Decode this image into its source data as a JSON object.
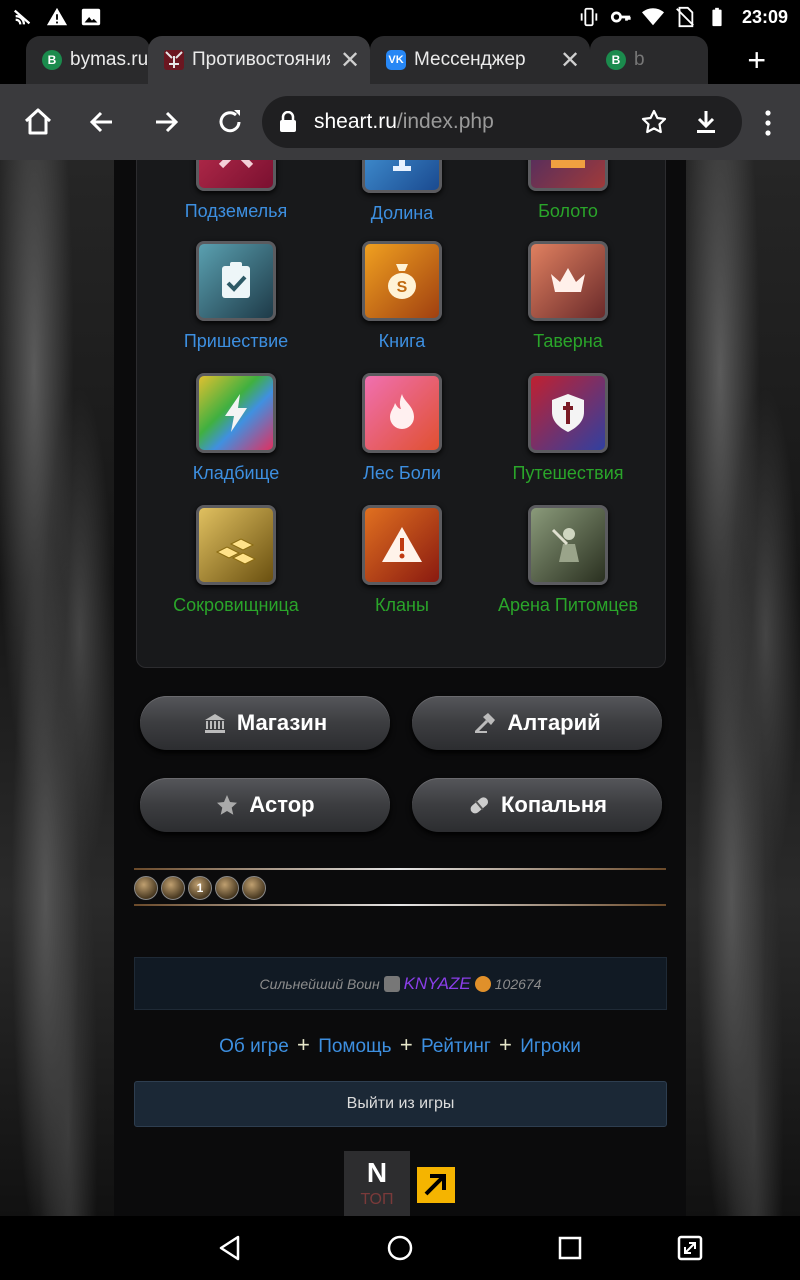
{
  "status_bar": {
    "time": "23:09",
    "icons": [
      "no-cast-icon",
      "warning-icon",
      "image-icon",
      "vibrate-icon",
      "key-icon",
      "wifi-icon",
      "no-sim-icon",
      "battery-icon"
    ]
  },
  "tabs": [
    {
      "favicon": "B",
      "title": "bymas.ru",
      "active": false
    },
    {
      "favicon": "",
      "title": "Противостояния",
      "active": true
    },
    {
      "favicon": "VK",
      "title": "Мессенджер",
      "active": false
    },
    {
      "favicon": "B",
      "title": "b",
      "active": false
    }
  ],
  "toolbar": {
    "url_host": "sheart.ru",
    "url_path": "/index.php"
  },
  "grid": [
    {
      "label": "Подземелья",
      "color": "blue",
      "icon": "swords-icon"
    },
    {
      "label": "Долина",
      "color": "blue",
      "icon": "trophy-icon"
    },
    {
      "label": "Болото",
      "color": "green",
      "icon": "castle-icon"
    },
    {
      "label": "Пришествие",
      "color": "blue",
      "icon": "clipboard-check-icon"
    },
    {
      "label": "Книга",
      "color": "blue",
      "icon": "money-bag-icon"
    },
    {
      "label": "Таверна",
      "color": "green",
      "icon": "crown-icon"
    },
    {
      "label": "Кладбище",
      "color": "blue",
      "icon": "lightning-icon"
    },
    {
      "label": "Лес Боли",
      "color": "blue",
      "icon": "fire-icon"
    },
    {
      "label": "Путешествия",
      "color": "green",
      "icon": "shield-sword-icon"
    },
    {
      "label": "Сокровищница",
      "color": "green",
      "icon": "gold-bars-icon"
    },
    {
      "label": "Кланы",
      "color": "green",
      "icon": "alert-icon"
    },
    {
      "label": "Арена Питомцев",
      "color": "green",
      "icon": "warrior-icon"
    }
  ],
  "buttons": {
    "shop": "Магазин",
    "altar": "Алтарий",
    "astor": "Астор",
    "mine": "Копальня"
  },
  "badge_number": "1",
  "strongest": {
    "label": "Сильнейший Воин",
    "nick": "KNYAZE",
    "score": "102674"
  },
  "links": {
    "about": "Об игре",
    "help": "Помощь",
    "rating": "Рейтинг",
    "players": "Игроки",
    "separator": "+"
  },
  "logout": "Выйти из игры",
  "counter": {
    "letter": "N",
    "text": "ТОП"
  }
}
